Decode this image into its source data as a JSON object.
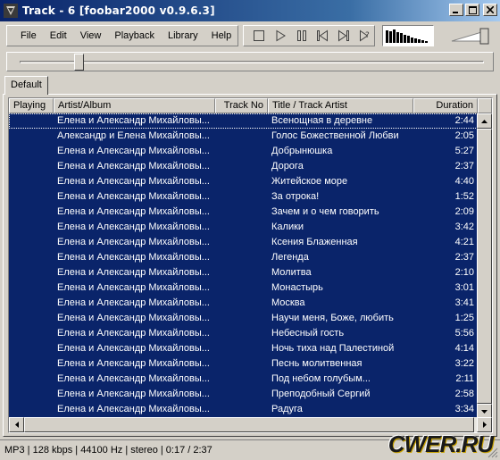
{
  "window": {
    "title": "Track - 6  [foobar2000 v0.9.6.3]"
  },
  "menu": [
    "File",
    "Edit",
    "View",
    "Playback",
    "Library",
    "Help"
  ],
  "transport": [
    "stop-icon",
    "play-icon",
    "pause-icon",
    "previous-icon",
    "next-icon",
    "random-icon"
  ],
  "seek": {
    "position_fraction": 0.127
  },
  "volume": {
    "level_fraction": 0.9
  },
  "tabs": [
    "Default"
  ],
  "columns": [
    "Playing",
    "Artist/Album",
    "Track No",
    "Title / Track Artist",
    "Duration"
  ],
  "tracks": [
    {
      "artist": "Елена и Александр Михайловы...",
      "track": "",
      "title": "Всенощная в деревне",
      "duration": "2:44"
    },
    {
      "artist": "Александр и Елена Михайловы...",
      "track": "",
      "title": "Голос Божественной Любви",
      "duration": "2:05"
    },
    {
      "artist": "Елена и Александр Михайловы...",
      "track": "",
      "title": "Добрынюшка",
      "duration": "5:27"
    },
    {
      "artist": "Елена и Александр Михайловы...",
      "track": "",
      "title": "Дорога",
      "duration": "2:37"
    },
    {
      "artist": "Елена и Александр Михайловы...",
      "track": "",
      "title": "Житейское море",
      "duration": "4:40"
    },
    {
      "artist": "Елена и Александр Михайловы...",
      "track": "",
      "title": "За отрока!",
      "duration": "1:52"
    },
    {
      "artist": "Елена и Александр Михайловы...",
      "track": "",
      "title": "Зачем и о чем говорить",
      "duration": "2:09"
    },
    {
      "artist": "Елена и Александр Михайловы...",
      "track": "",
      "title": "Калики",
      "duration": "3:42"
    },
    {
      "artist": "Елена и Александр Михайловы...",
      "track": "",
      "title": "Ксения Блаженная",
      "duration": "4:21"
    },
    {
      "artist": "Елена и Александр Михайловы...",
      "track": "",
      "title": "Легенда",
      "duration": "2:37"
    },
    {
      "artist": "Елена и Александр Михайловы...",
      "track": "",
      "title": "Молитва",
      "duration": "2:10"
    },
    {
      "artist": "Елена и Александр Михайловы...",
      "track": "",
      "title": "Монастырь",
      "duration": "3:01"
    },
    {
      "artist": "Елена и Александр Михайловы...",
      "track": "",
      "title": "Москва",
      "duration": "3:41"
    },
    {
      "artist": "Елена и Александр Михайловы...",
      "track": "",
      "title": "Научи меня, Боже, любить",
      "duration": "1:25"
    },
    {
      "artist": "Елена и Александр Михайловы...",
      "track": "",
      "title": "Небесный гость",
      "duration": "5:56"
    },
    {
      "artist": "Елена и Александр Михайловы...",
      "track": "",
      "title": "Ночь тиха над Палестиной",
      "duration": "4:14"
    },
    {
      "artist": "Елена и Александр Михайловы...",
      "track": "",
      "title": "Песнь молитвенная",
      "duration": "3:22"
    },
    {
      "artist": "Елена и Александр Михайловы...",
      "track": "",
      "title": "Под небом голубым...",
      "duration": "2:11"
    },
    {
      "artist": "Елена и Александр Михайловы...",
      "track": "",
      "title": "Преподобный Сергий",
      "duration": "2:58"
    },
    {
      "artist": "Елена и Александр Михайловы...",
      "track": "",
      "title": "Радуга",
      "duration": "3:34"
    }
  ],
  "status": "MP3 | 128 kbps | 44100 Hz | stereo | 0:17 / 2:37",
  "watermark": "CWER.RU",
  "colors": {
    "selection": "#0a246a",
    "titlebar_start": "#0a246a",
    "titlebar_end": "#a6caf0"
  }
}
